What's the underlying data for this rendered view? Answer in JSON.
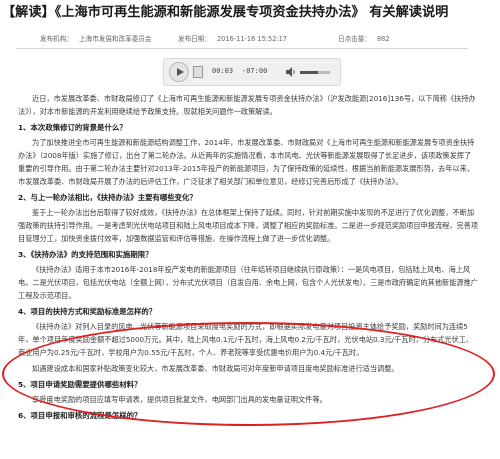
{
  "title": "【解读】《上海市可再生能源和新能源发展专项资金扶持办法》 有关解读说明",
  "meta": {
    "publisher_label": "发布机构：",
    "publisher": "上海市发展和改革委员会",
    "date_label": "发布日期：",
    "date": "2016-11-16 15:52:17",
    "views_label": "日点击量：",
    "views": "882"
  },
  "player": {
    "current_time": "00:03",
    "total_time": "-07:00",
    "volume_level": 0.6
  },
  "paragraphs": [
    {
      "type": "p",
      "text": "近日，市发展改革委、市财政局修订了《上海市可再生能源和新能源发展专项资金扶持办法》（沪发改能源[2016]136号，以下简称《扶持办法》），对本市新能源的开发利用继续给予政策支持。现就相关问题作一政策解读。"
    },
    {
      "type": "h",
      "text": "1、本次政策修订的背景是什么？"
    },
    {
      "type": "p",
      "text": "为了加快推进全市可再生能源和新能源结构调整工作，2014年，市发展改革委、市财政局对《上海市可再生能源和新能源发展专项资金扶持办法》（2008年版）实施了修订，出台了第二轮办法。从近两年的实施情况看，本市风电、光伏等新能源发展取得了长足进步，该项政策发挥了重要的引导作用。由于第二轮办法主要针对2013年-2015年投产的新能源项目，为了保持政策的延续性，根据当前新能源发展形势，去年以来，市发展改革委、市财政局开展了办法的后评估工作，广泛征求了相关部门和单位意见，经修订完善后形成了《扶持办法》。"
    },
    {
      "type": "h",
      "text": "2、与上一轮办法相比，《扶持办法》主要有哪些变化？"
    },
    {
      "type": "p",
      "text": "鉴于上一轮办法出台后取得了较好成效，《扶持办法》在总体框架上保持了延续。同时，针对前期实施中发现的不足进行了优化调整，不断加强政策的扶持引导作用。一是考虑到光伏电站项目和陆上风电项目成本下降，调整了相应的奖励标准。二是进一步规范奖励项目申报流程，完善项目管理分工，加快资金拨付效率，加强数据监管和评估等措施，在操作流程上做了进一步优化调整。"
    },
    {
      "type": "h",
      "text": "3、《扶持办法》的支持范围和实施期限？"
    },
    {
      "type": "p",
      "text": "《扶持办法》适用于本市2016年-2018年投产发电的新能源项目（往年结转项目继续执行原政策）：一是风电项目，包括陆上风电、海上风电。二是光伏项目，包括光伏电站（全额上网），分布式光伏项目（自发自用、余电上网，包含个人光伏发电）。三是市政府确定的其他新能源推广工程及示范项目。"
    },
    {
      "type": "h",
      "text": "4、项目的扶持方式和奖励标准是怎样的？"
    },
    {
      "type": "p",
      "text": "《扶持办法》对列入目录的风电、光伏等新能源项目采取度电奖励的方式，即根据实际发电量对项目投资主体给予奖励，奖励时间为连续5年，单个项目年度奖励金额不超过5000万元。其中，陆上风电0.1元/千瓦时，海上风电0.2元/千瓦时，光伏电站0.3元/千瓦时，分布式光伏工、商业用户为0.25元/千瓦时，学校用户为0.55元/千瓦时，个人、养老院等享受优惠电价用户为0.4元/千瓦时。"
    },
    {
      "type": "p",
      "text": "如遇建设成本和国家补贴政策变化较大，市发展改革委、市财政局可对年度新申请项目度电奖励标准进行适当调整。"
    },
    {
      "type": "h",
      "text": "5、项目申请奖励需要提供哪些材料？"
    },
    {
      "type": "p",
      "text": "享受度电奖励的项目应填写申请表，提供项目批复文件、电网部门出具的发电量证明文件等。"
    },
    {
      "type": "h",
      "text": "6、项目申报和审核的流程是怎样的？"
    }
  ]
}
